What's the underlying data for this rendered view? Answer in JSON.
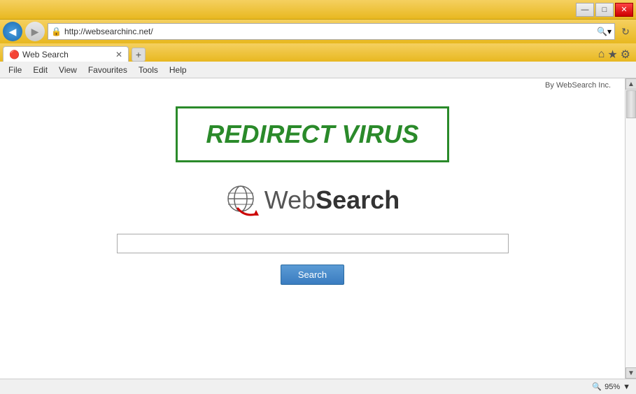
{
  "window": {
    "min_btn": "—",
    "max_btn": "□",
    "close_btn": "✕"
  },
  "addressbar": {
    "url": "http://websearchinc.net/",
    "search_icon": "🔍",
    "refresh_icon": "↻"
  },
  "tab": {
    "icon": "🔴",
    "label": "Web Search",
    "close": "✕"
  },
  "toolbar_icons": {
    "home": "⌂",
    "favorites": "★",
    "settings": "⚙"
  },
  "menu": {
    "items": [
      "File",
      "Edit",
      "View",
      "Favourites",
      "Tools",
      "Help"
    ],
    "by_text": "By WebSearch Inc."
  },
  "main": {
    "redirect_label": "REDIRECT VIRUS",
    "logo_web": "Web",
    "logo_search": "Search",
    "search_placeholder": "",
    "search_button": "Search",
    "by_websearch": "By WebSearch Inc."
  },
  "statusbar": {
    "zoom_icon": "🔍",
    "zoom_level": "95%",
    "dropdown": "▼"
  },
  "scrollbar": {
    "up": "▲",
    "down": "▼"
  }
}
